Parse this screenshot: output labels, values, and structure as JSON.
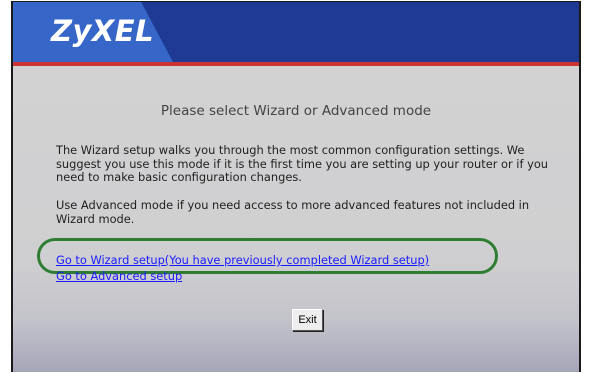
{
  "header": {
    "logo_text": "ZyXEL",
    "brand_color": "#1f3a93",
    "accent_color": "#3566c8",
    "stripe_color": "#cc3333"
  },
  "main": {
    "title": "Please select Wizard or Advanced mode",
    "paragraph1": "The Wizard setup walks you through the most common configuration settings. We suggest you use this mode if it is the first time you are setting up your router or if you need to make basic configuration changes.",
    "paragraph2": "Use Advanced mode if you need access to more advanced features not included in Wizard mode.",
    "links": {
      "wizard": "Go to Wizard setup(You have previously completed Wizard setup)",
      "advanced": "Go to Advanced setup"
    },
    "exit_label": "Exit"
  },
  "annotation": {
    "highlight_color": "#2e7d32"
  }
}
